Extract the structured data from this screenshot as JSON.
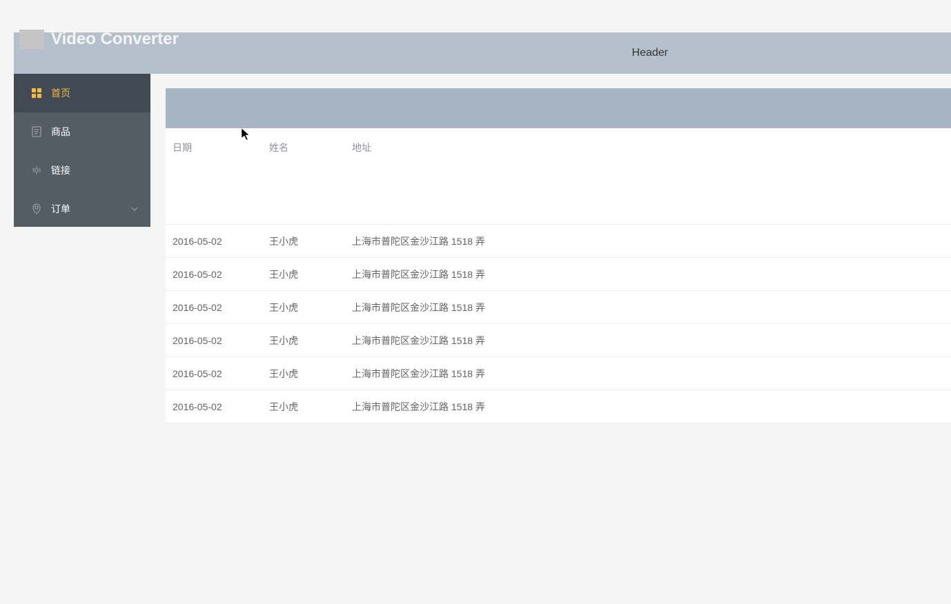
{
  "header": {
    "logo_text": "Video Converter",
    "title": "Header"
  },
  "sidebar": {
    "items": [
      {
        "label": "首页",
        "icon": "grid-icon",
        "active": true
      },
      {
        "label": "商品",
        "icon": "document-icon",
        "active": false
      },
      {
        "label": "链接",
        "icon": "gear-icon",
        "active": false
      },
      {
        "label": "订单",
        "icon": "location-icon",
        "active": false,
        "has_chevron": true
      }
    ]
  },
  "table": {
    "columns": [
      {
        "key": "date",
        "label": "日期"
      },
      {
        "key": "name",
        "label": "姓名"
      },
      {
        "key": "address",
        "label": "地址"
      }
    ],
    "rows": [
      {
        "date": "2016-05-02",
        "name": "王小虎",
        "address": "上海市普陀区金沙江路 1518 弄"
      },
      {
        "date": "2016-05-02",
        "name": "王小虎",
        "address": "上海市普陀区金沙江路 1518 弄"
      },
      {
        "date": "2016-05-02",
        "name": "王小虎",
        "address": "上海市普陀区金沙江路 1518 弄"
      },
      {
        "date": "2016-05-02",
        "name": "王小虎",
        "address": "上海市普陀区金沙江路 1518 弄"
      },
      {
        "date": "2016-05-02",
        "name": "王小虎",
        "address": "上海市普陀区金沙江路 1518 弄"
      },
      {
        "date": "2016-05-02",
        "name": "王小虎",
        "address": "上海市普陀区金沙江路 1518 弄"
      }
    ]
  }
}
